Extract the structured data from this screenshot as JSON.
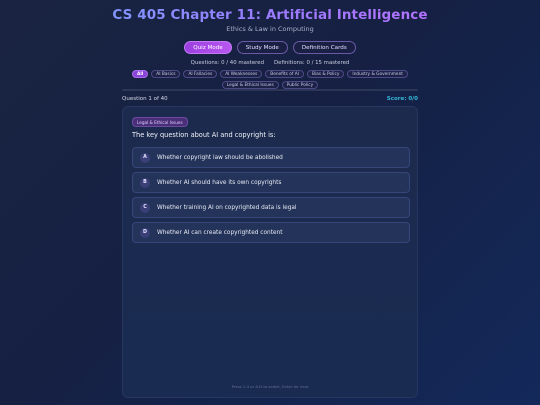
{
  "header": {
    "title": "CS 405 Chapter 11: Artificial Intelligence",
    "subtitle": "Ethics & Law in Computing"
  },
  "modes": [
    {
      "label": "Quiz Mode",
      "active": true
    },
    {
      "label": "Study Mode",
      "active": false
    },
    {
      "label": "Definition Cards",
      "active": false
    }
  ],
  "stats": {
    "questions": "Questions: 0 / 40 mastered",
    "definitions": "Definitions: 0 / 15 mastered"
  },
  "categories": [
    "All",
    "AI Basics",
    "AI Fallacies",
    "AI Weaknesses",
    "Benefits of AI",
    "Bias & Policy",
    "Industry & Government",
    "Legal & Ethical Issues",
    "Public Policy"
  ],
  "quiz": {
    "question_counter": "Question 1 of 40",
    "score": "Score: 0/0",
    "category_badge": "Legal & Ethical Issues",
    "question_text": "The key question about AI and copyright is:",
    "options": [
      {
        "letter": "A",
        "text": "Whether copyright law should be abolished"
      },
      {
        "letter": "B",
        "text": "Whether AI should have its own copyrights"
      },
      {
        "letter": "C",
        "text": "Whether training AI on copyrighted data is legal"
      },
      {
        "letter": "D",
        "text": "Whether AI can create copyrighted content"
      }
    ],
    "hint": "Press 1-4 or A-D to select, Enter for next"
  },
  "colors": {
    "accent": "#9c3fe0",
    "score": "#34b7d8",
    "background": "#152043"
  }
}
